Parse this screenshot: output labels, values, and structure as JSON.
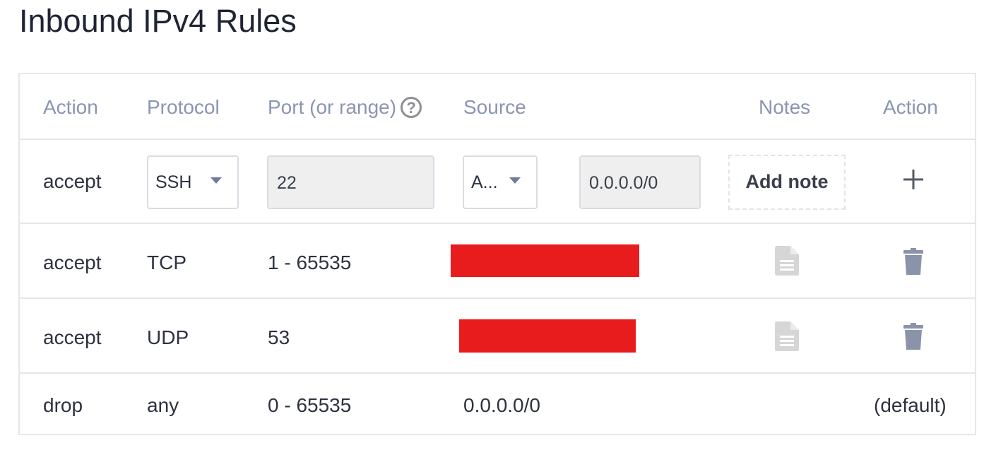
{
  "page": {
    "title": "Inbound IPv4 Rules"
  },
  "table": {
    "headers": {
      "action": "Action",
      "protocol": "Protocol",
      "port": "Port (or range)",
      "port_help_icon": "?",
      "source": "Source",
      "notes": "Notes",
      "action_col": "Action"
    },
    "new_rule": {
      "action": "accept",
      "protocol_selected": "SSH",
      "port_value": "22",
      "source_selected": "A...",
      "source_cidr": "0.0.0.0/0",
      "add_note_label": "Add note",
      "add_icon": "plus-icon"
    },
    "rows": [
      {
        "action": "accept",
        "protocol": "TCP",
        "port": "1 - 65535",
        "source_redacted": true,
        "notes_icon": "document-icon",
        "action_icon": "trash-icon"
      },
      {
        "action": "accept",
        "protocol": "UDP",
        "port": "53",
        "source_redacted": true,
        "notes_icon": "document-icon",
        "action_icon": "trash-icon"
      },
      {
        "action": "drop",
        "protocol": "any",
        "port": "0 - 65535",
        "source": "0.0.0.0/0",
        "action_label": "(default)"
      }
    ]
  },
  "colors": {
    "header_text": "#8a95b3",
    "redaction": "#e81c1c",
    "icon_muted": "#d6d6d6",
    "trash": "#8a93aa"
  }
}
